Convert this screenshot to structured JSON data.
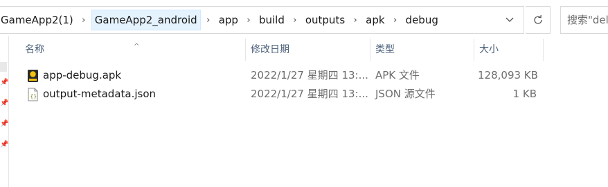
{
  "breadcrumbs": [
    "GameApp2(1)",
    "GameApp2_android",
    "app",
    "build",
    "outputs",
    "apk",
    "debug"
  ],
  "address_dropdown_icon": "chevron-down-icon",
  "refresh_icon": "refresh-icon",
  "search": {
    "placeholder": "搜索\"debug\"",
    "shown_text": "搜索\"del"
  },
  "columns": {
    "name": "名称",
    "date": "修改日期",
    "type": "类型",
    "size": "大小"
  },
  "sort_indicator": "^",
  "files": [
    {
      "name": "app-debug.apk",
      "date": "2022/1/27 星期四 13:...",
      "type": "APK 文件",
      "size": "128,093 KB",
      "icon": "apk-file-icon"
    },
    {
      "name": "output-metadata.json",
      "date": "2022/1/27 星期四 13:...",
      "type": "JSON 源文件",
      "size": "1 KB",
      "icon": "json-file-icon"
    }
  ],
  "colors": {
    "hover_bg": "#e5f3ff",
    "border": "#d9d9d9",
    "header_text": "#4c607a",
    "apk_icon_yellow": "#f4c20d"
  }
}
